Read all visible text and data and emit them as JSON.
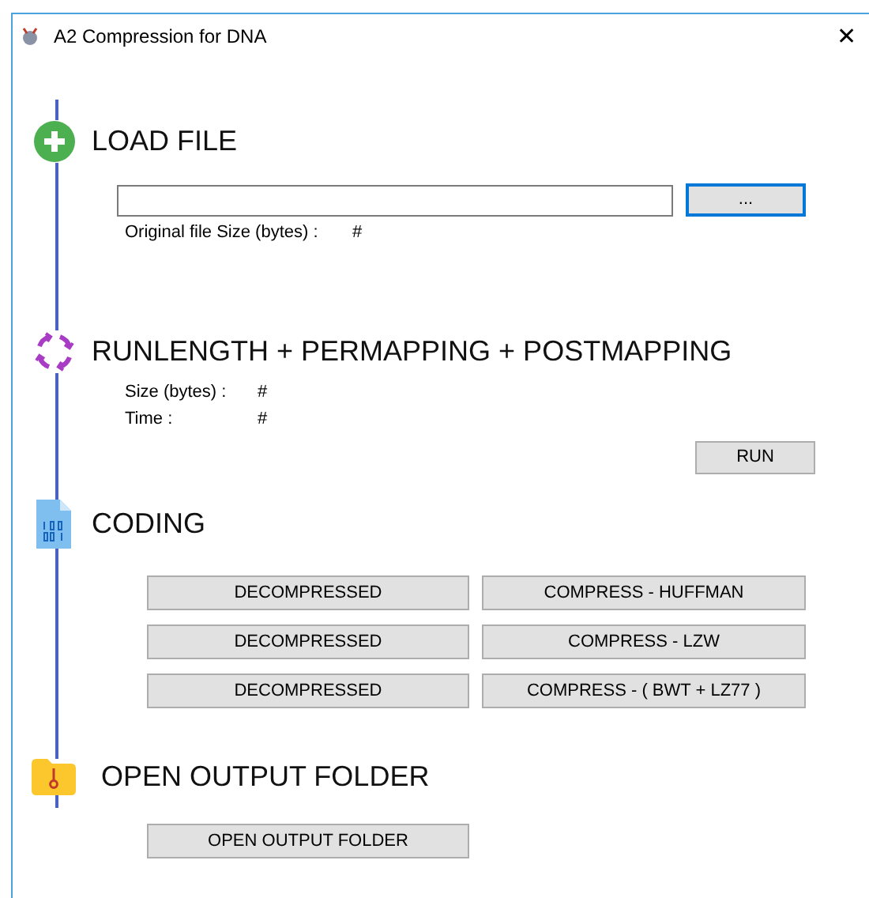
{
  "window": {
    "title": "A2 Compression for DNA",
    "close": "✕"
  },
  "sections": [
    {
      "kind": "load",
      "heading": "LOAD FILE",
      "browse_button": {
        "label": "...",
        "focused": true
      },
      "info": [
        {
          "label": "Original file Size (bytes) :",
          "value": "#"
        }
      ]
    },
    {
      "kind": "process",
      "heading": "RUNLENGTH + PERMAPPING + POSTMAPPING",
      "info": [
        {
          "label": "Size (bytes) :",
          "value": "#"
        },
        {
          "label": "Time :",
          "value": "#"
        }
      ],
      "button": "RUN"
    },
    {
      "kind": "coding",
      "heading": "CODING",
      "rows": [
        {
          "decompress": "DECOMPRESSED",
          "compress": "COMPRESS - HUFFMAN"
        },
        {
          "decompress": "DECOMPRESSED",
          "compress": "COMPRESS - LZW"
        },
        {
          "decompress": "DECOMPRESSED",
          "compress": "COMPRESS - ( BWT + LZ77 )"
        }
      ]
    },
    {
      "kind": "output",
      "heading": "OPEN OUTPUT FOLDER",
      "button": "OPEN OUTPUT FOLDER"
    }
  ]
}
